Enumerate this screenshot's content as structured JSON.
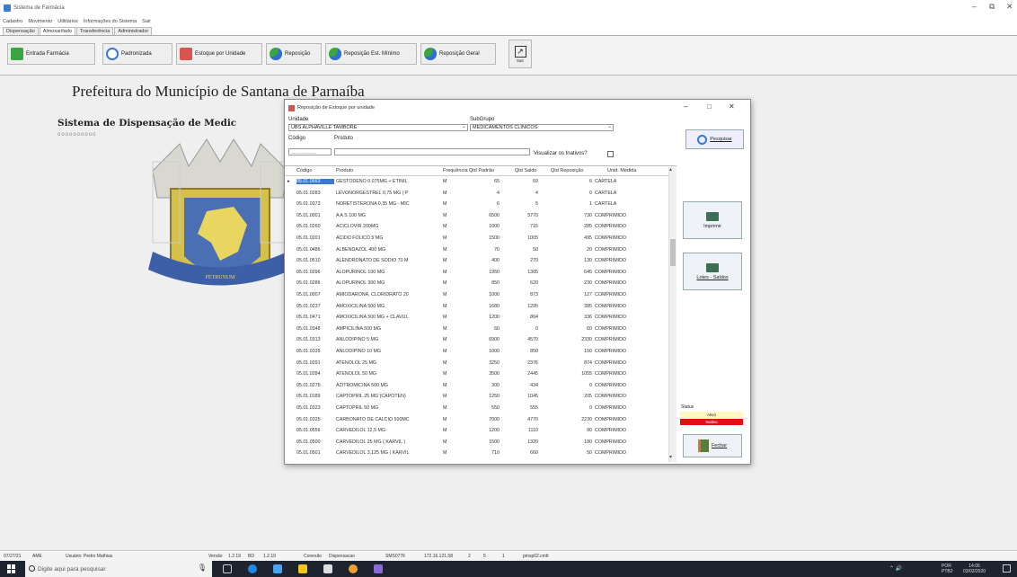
{
  "window": {
    "title": "Sistema de Farmácia",
    "minimize": "–",
    "restore": "⧉",
    "close": "✕"
  },
  "menu": [
    "Cadastro",
    "Movimento",
    "Utilitários",
    "Informações do Sistema",
    "Sair"
  ],
  "tabs": [
    "Dispensação",
    "Almoxarifado",
    "Transferência",
    "Administrador"
  ],
  "toolbar": {
    "entrada": "Entrada Farmácia",
    "padronizada": "Padronizada",
    "estoque_unidade": "Estoque por Unidade",
    "reposicao": "Reposição",
    "reposicao_minimo": "Reposição Est. Mínimo",
    "reposicao_geral": "Reposição Geral",
    "sair": "Sair"
  },
  "background": {
    "prefeitura": "Prefeitura do Município de Santana de Parnaíba",
    "sistema": "Sistema de Dispensação de Medic",
    "dots": "oooooooooo"
  },
  "dialog": {
    "title": "Reposição de Estoque por unidade",
    "unidade_label": "Unidade",
    "unidade_value": "UBS ALPHAVILLE TAMBORÉ",
    "subgrupo_label": "SubGrupo",
    "subgrupo_value": "MEDICAMENTOS CLINICOS",
    "codigo_label": "Código",
    "produto_label": "Produto",
    "codigo_mask": "__.__.____",
    "visualizar_label": "Visualizar os Inativos?",
    "pesquisar": "Pesquisar",
    "imprimir": "Imprimir",
    "lotes": "Lotes - Saldos",
    "status_label": "Status",
    "status_ativo": "Ativo",
    "status_inativo": "Inativo",
    "fechar": "Fechar"
  },
  "grid": {
    "headers": [
      "Código",
      "Produto",
      "Frequência",
      "Qtd Padrão",
      "Qtd Saldo",
      "Qtd Reposição",
      "Unid. Medida"
    ],
    "rows": [
      [
        "05.01.0563",
        "GESTODENO 0.075MG + ETINIL",
        "M",
        "65",
        "59",
        "6",
        "CARTELA"
      ],
      [
        "05.01.0283",
        "LEVONORGESTREL 0,75 MG ( P",
        "M",
        "4",
        "4",
        "0",
        "CARTELA"
      ],
      [
        "05.01.0373",
        "NORETISTERONA 0,35 MG - MIC",
        "M",
        "6",
        "5",
        "1",
        "CARTELA"
      ],
      [
        "05.01.0001",
        "A A S 100 MG",
        "M",
        "6500",
        "5770",
        "730",
        "COMPRIMIDO"
      ],
      [
        "05.01.0260",
        "ACICLOVIR 200MG",
        "M",
        "1000",
        "715",
        "285",
        "COMPRIMIDO"
      ],
      [
        "05.01.0201",
        "ÁCIDO FÓLICO 5 MG",
        "M",
        "1500",
        "1005",
        "495",
        "COMPRIMIDO"
      ],
      [
        "05.01.0486",
        "ALBENDAZOL 400 MG",
        "M",
        "70",
        "50",
        "20",
        "COMPRIMIDO"
      ],
      [
        "05.01.0510",
        "ALENDRONATO DE SÓDIO 70 M",
        "M",
        "400",
        "270",
        "130",
        "COMPRIMIDO"
      ],
      [
        "05.01.0296",
        "ALOPURINOL 100 MG",
        "M",
        "1950",
        "1305",
        "645",
        "COMPRIMIDO"
      ],
      [
        "05.01.0286",
        "ALOPURINOL 300 MG",
        "M",
        "850",
        "620",
        "230",
        "COMPRIMIDO"
      ],
      [
        "05.01.0007",
        "AMIODARONA, CLORIDRATO 20",
        "M",
        "1000",
        "873",
        "127",
        "COMPRIMIDO"
      ],
      [
        "05.01.0237",
        "AMOXICILINA 500 MG",
        "M",
        "1680",
        "1295",
        "385",
        "COMPRIMIDO"
      ],
      [
        "05.01.0471",
        "AMOXICILINA 500 MG + CLAVUL",
        "M",
        "1200",
        "864",
        "336",
        "COMPRIMIDO"
      ],
      [
        "05.01.0348",
        "AMPICILINA 500 MG",
        "M",
        "60",
        "0",
        "60",
        "COMPRIMIDO"
      ],
      [
        "05.01.0313",
        "ANLODIPINO 5 MG",
        "M",
        "6900",
        "4570",
        "2330",
        "COMPRIMIDO"
      ],
      [
        "05.01.0335",
        "ANLODIPINO 10 MG",
        "M",
        "1000",
        "850",
        "150",
        "COMPRIMIDO"
      ],
      [
        "05.01.0291",
        "ATENOLOL 25 MG",
        "M",
        "3250",
        "2376",
        "874",
        "COMPRIMIDO"
      ],
      [
        "05.01.0284",
        "ATENOLOL 50 MG",
        "M",
        "3500",
        "2445",
        "1055",
        "COMPRIMIDO"
      ],
      [
        "05.01.0275",
        "AZITROMICINA 500 MG",
        "M",
        "300",
        "434",
        "0",
        "COMPRIMIDO"
      ],
      [
        "05.01.0189",
        "CAPTOPRIL 25 MG (CAPOTEN)",
        "M",
        "1250",
        "1045",
        "205",
        "COMPRIMIDO"
      ],
      [
        "05.01.0323",
        "CAPTOPRIL 50 MG",
        "M",
        "550",
        "555",
        "0",
        "COMPRIMIDO"
      ],
      [
        "05.01.0325",
        "CARBONATO DE CALCIO 500MC",
        "M",
        "7000",
        "4770",
        "2230",
        "COMPRIMIDO"
      ],
      [
        "05.01.0556",
        "CARVEDILOL 12,5 MG",
        "M",
        "1200",
        "1110",
        "90",
        "COMPRIMIDO"
      ],
      [
        "05.01.0500",
        "CARVEDILOL 25 MG ( KARVIL )",
        "M",
        "1500",
        "1320",
        "180",
        "COMPRIMIDO"
      ],
      [
        "05.01.0501",
        "CARVEDILOL 3,125 MG ( KARVIL",
        "M",
        "710",
        "660",
        "50",
        "COMPRIMIDO"
      ]
    ]
  },
  "statusbar": [
    "07/27/21",
    "AME",
    "Usuário: Pedro Mathias",
    "Versão",
    "1.2.19",
    "BD",
    "1.2.19",
    "Conexão",
    "Dispensacao",
    "SMS0776",
    "172.16.121.58",
    "2",
    "5",
    "1",
    "pmsp02.cmtt"
  ],
  "taskbar": {
    "search": "Digite aqui para pesquisar",
    "lang": "POR",
    "lang2": "PTB2",
    "time": "14:06",
    "date": "03/02/2020"
  }
}
